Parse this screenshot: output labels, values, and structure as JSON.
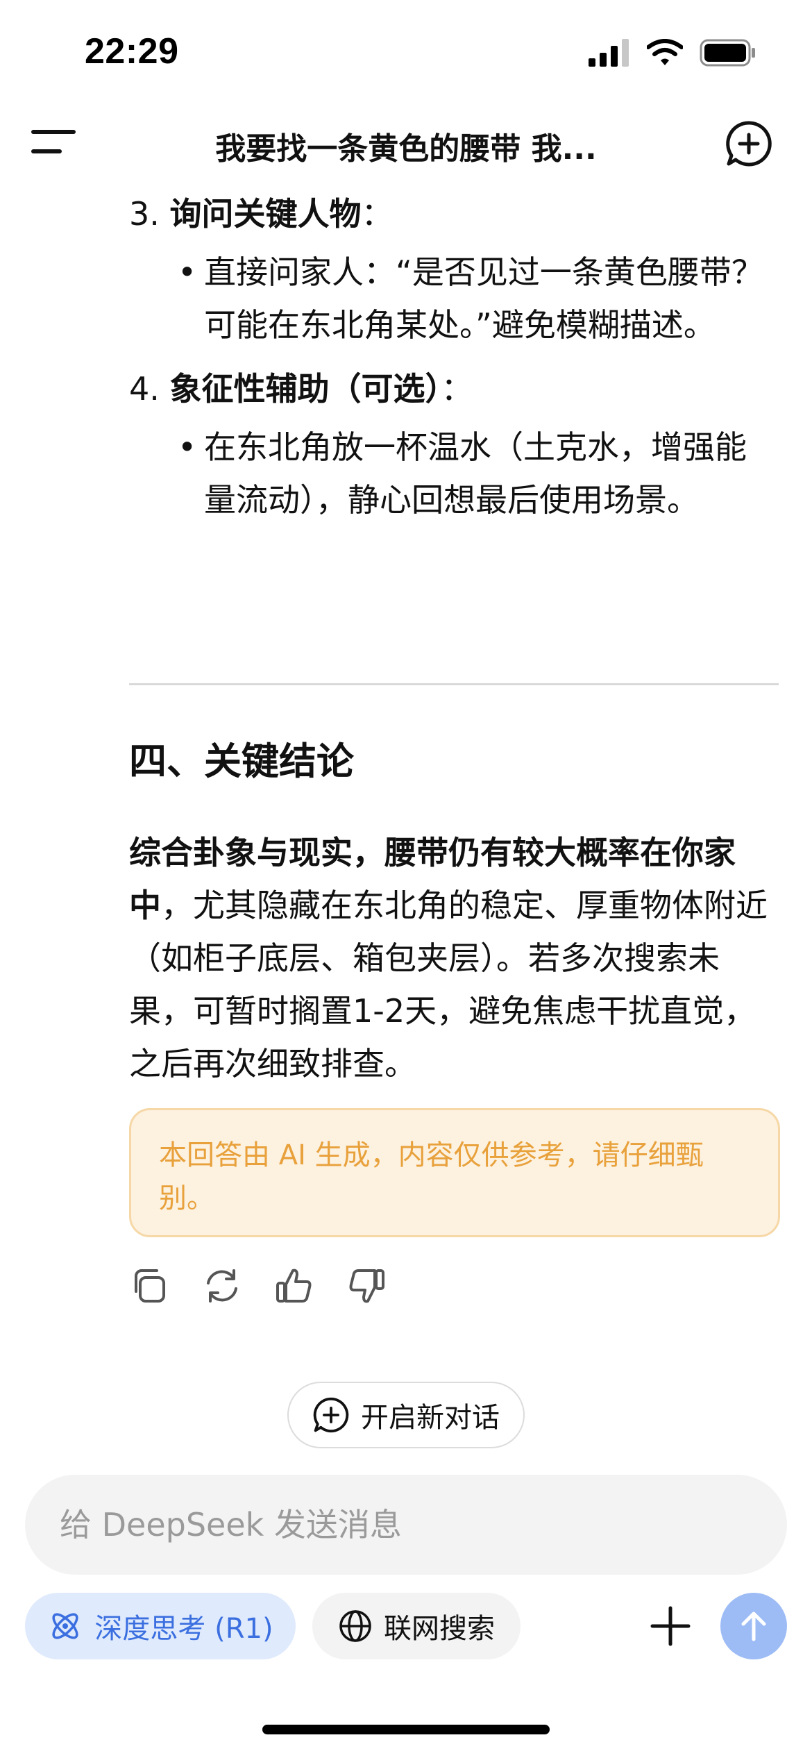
{
  "status_bar": {
    "time": "22:29",
    "icons": [
      "signal-icon",
      "wifi-icon",
      "battery-icon"
    ]
  },
  "header": {
    "title": "我要找一条黄色的腰带 我...",
    "menu_icon": "menu-icon",
    "new_chat_icon": "new-chat-icon"
  },
  "content": {
    "items": [
      {
        "number": "3.",
        "title": "询问关键人物",
        "colon": "：",
        "bullet": "直接问家人：“是否见过一条黄色腰带？可能在东北角某处。”避免模糊描述。"
      },
      {
        "number": "4.",
        "title": "象征性辅助（可选）",
        "colon": "：",
        "bullet": "在东北角放一杯温水（土克水，增强能量流动），静心回想最后使用场景。"
      }
    ],
    "section_heading": "四、关键结论",
    "conclusion_bold": "综合卦象与现实，腰带仍有较大概率在你家中",
    "conclusion_rest": "，尤其隐藏在东北角的稳定、厚重物体附近（如柜子底层、箱包夹层）。若多次搜索未果，可暂时搁置1-2天，避免焦虑干扰直觉，之后再次细致排查。",
    "disclaimer": "本回答由 AI 生成，内容仅供参考，请仔细甄别。"
  },
  "actions": [
    "copy-icon",
    "regenerate-icon",
    "thumbs-up-icon",
    "thumbs-down-icon"
  ],
  "new_chat_button": {
    "label": "开启新对话"
  },
  "composer": {
    "placeholder": "给 DeepSeek 发送消息",
    "value": ""
  },
  "tools": {
    "deep_think_label": "深度思考 (R1)",
    "web_search_label": "联网搜索"
  },
  "colors": {
    "accent": "#3b6fe0",
    "accent_bg": "#dfeafc",
    "send_button": "#9dbcf6",
    "disclaimer_text": "#e8a13b",
    "disclaimer_bg": "#fdf1e0",
    "disclaimer_border": "#f6d8a7"
  }
}
